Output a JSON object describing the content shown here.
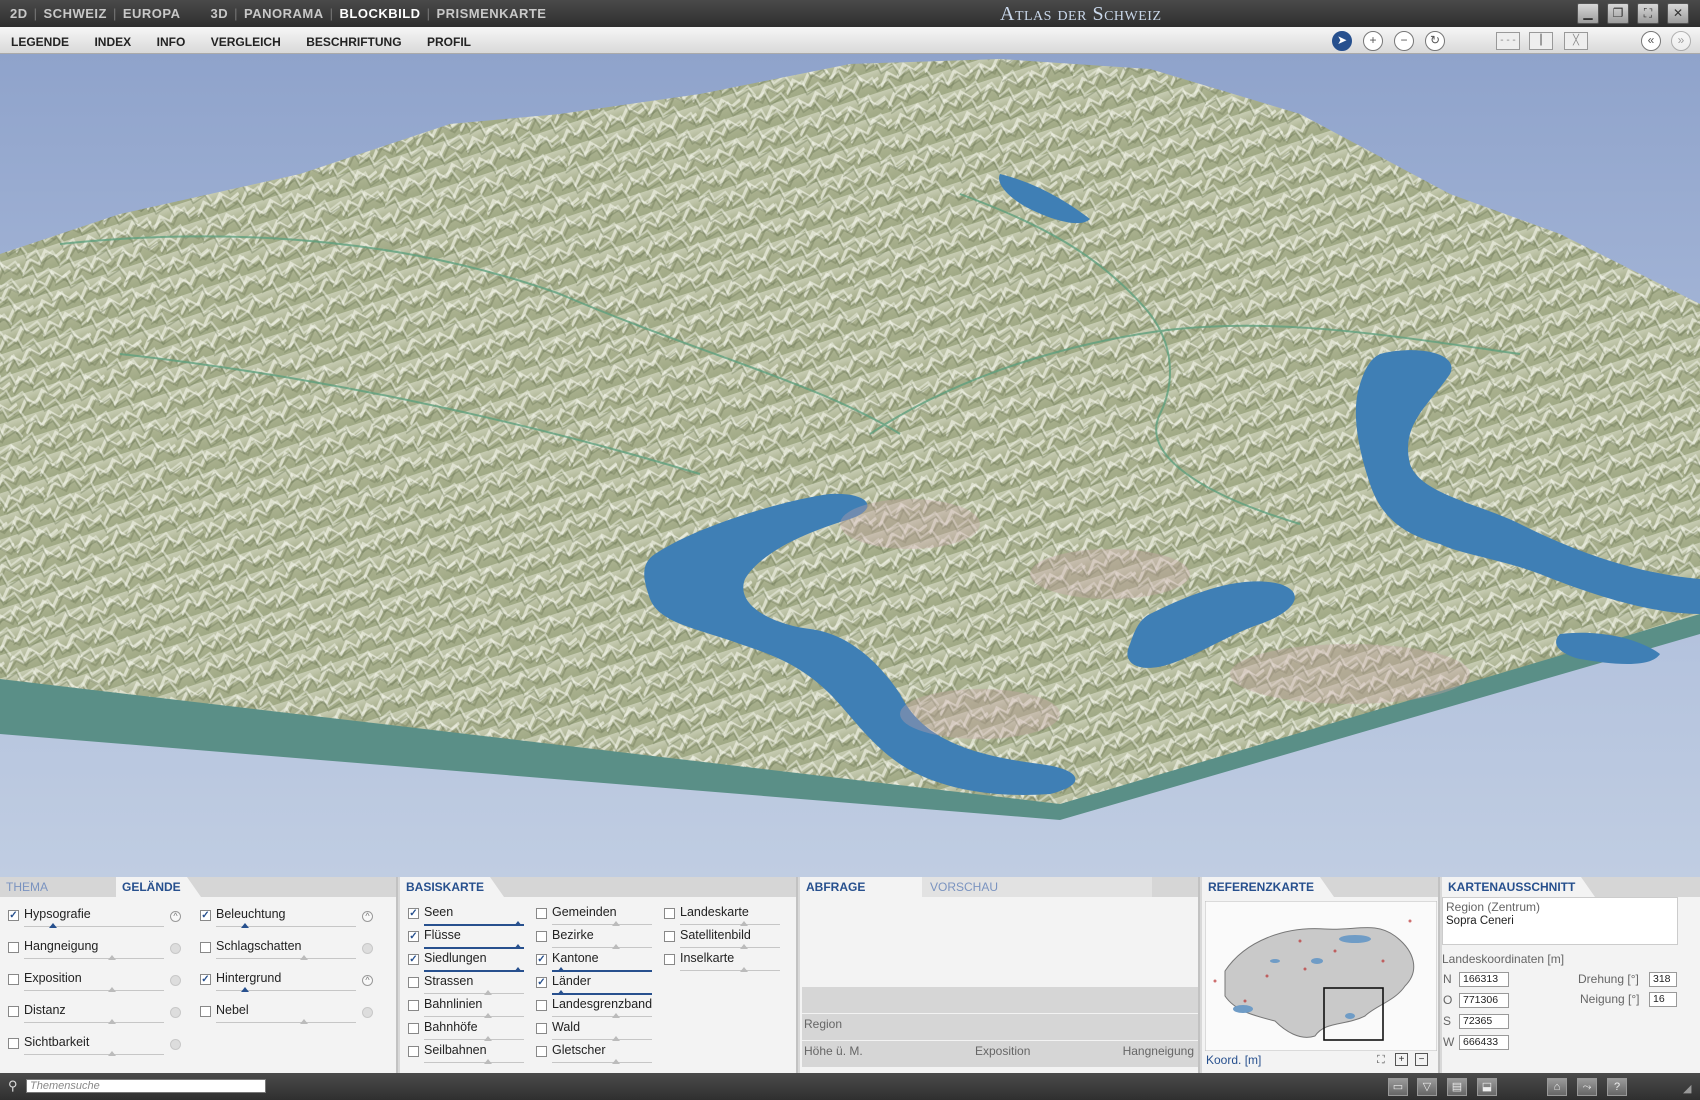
{
  "titlebar": {
    "mode_2d": "2D",
    "schweiz": "SCHWEIZ",
    "europa": "EUROPA",
    "mode_3d": "3D",
    "panorama": "PANORAMA",
    "blockbild": "BLOCKBILD",
    "prismenkarte": "PRISMENKARTE",
    "title": "Atlas der Schweiz"
  },
  "menu": {
    "legende": "LEGENDE",
    "index": "INDEX",
    "info": "INFO",
    "vergleich": "VERGLEICH",
    "beschriftung": "BESCHRIFTUNG",
    "profil": "PROFIL"
  },
  "icons": {
    "select": "arrow-icon",
    "zoom_in": "zoom-in-icon",
    "zoom_out": "zoom-out-icon",
    "rotate": "rotate-icon",
    "layout1": "layout-horizontal-icon",
    "layout2": "layout-split-icon",
    "layout3": "layout-cross-icon"
  },
  "colors": {
    "accent": "#27508e",
    "lake": "#3f7fb5",
    "terrain": "#a8b08e",
    "sky": "#8fa3cb"
  },
  "gelaende": {
    "tab_thema": "THEMA",
    "tab_gelaende": "GELÄNDE",
    "col1": [
      {
        "label": "Hypsografie",
        "checked": true
      },
      {
        "label": "Hangneigung",
        "checked": false
      },
      {
        "label": "Exposition",
        "checked": false
      },
      {
        "label": "Distanz",
        "checked": false
      },
      {
        "label": "Sichtbarkeit",
        "checked": false
      }
    ],
    "col2": [
      {
        "label": "Beleuchtung",
        "checked": true
      },
      {
        "label": "Schlagschatten",
        "checked": false
      },
      {
        "label": "Hintergrund",
        "checked": true
      },
      {
        "label": "Nebel",
        "checked": false
      }
    ]
  },
  "basiskarte": {
    "tab": "BASISKARTE",
    "col1": [
      {
        "label": "Seen",
        "checked": true
      },
      {
        "label": "Flüsse",
        "checked": true
      },
      {
        "label": "Siedlungen",
        "checked": true
      },
      {
        "label": "Strassen",
        "checked": false
      },
      {
        "label": "Bahnlinien",
        "checked": false
      },
      {
        "label": "Bahnhöfe",
        "checked": false
      },
      {
        "label": "Seilbahnen",
        "checked": false
      }
    ],
    "col2": [
      {
        "label": "Gemeinden",
        "checked": false
      },
      {
        "label": "Bezirke",
        "checked": false
      },
      {
        "label": "Kantone",
        "checked": true
      },
      {
        "label": "Länder",
        "checked": true
      },
      {
        "label": "Landesgrenzband",
        "checked": false
      },
      {
        "label": "Wald",
        "checked": false
      },
      {
        "label": "Gletscher",
        "checked": false
      }
    ],
    "col3": [
      {
        "label": "Landeskarte",
        "checked": false
      },
      {
        "label": "Satellitenbild",
        "checked": false
      },
      {
        "label": "Inselkarte",
        "checked": false
      }
    ]
  },
  "abfrage": {
    "tab_abfrage": "ABFRAGE",
    "tab_vorschau": "VORSCHAU",
    "region": "Region",
    "hoehe": "Höhe ü. M.",
    "exposition": "Exposition",
    "hangneigung": "Hangneigung"
  },
  "referenz": {
    "tab": "REFERENZKARTE",
    "koord": "Koord. [m]"
  },
  "kartenausschnitt": {
    "tab": "KARTENAUSSCHNITT",
    "region_label": "Region (Zentrum)",
    "region_value": "Sopra Ceneri",
    "coords_label": "Landeskoordinaten [m]",
    "n_label": "N",
    "n": "166313",
    "o_label": "O",
    "o": "771306",
    "s_label": "S",
    "s": "72365",
    "w_label": "W",
    "w": "666433",
    "drehung_label": "Drehung [°]",
    "drehung": "318",
    "neigung_label": "Neigung [°]",
    "neigung": "16"
  },
  "status": {
    "search_placeholder": "Themensuche"
  }
}
